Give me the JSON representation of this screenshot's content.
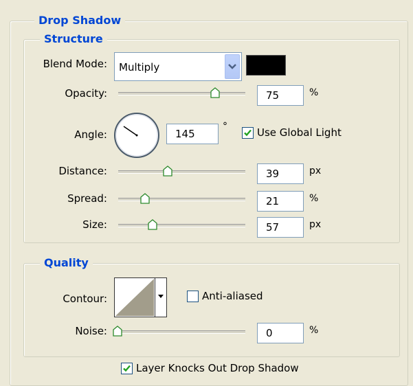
{
  "panel": {
    "title": "Drop Shadow",
    "structure": {
      "legend": "Structure",
      "blend_mode_label": "Blend Mode:",
      "blend_mode_value": "Multiply",
      "shadow_color": "#000000",
      "opacity_label": "Opacity:",
      "opacity_value": "75",
      "opacity_unit": "%",
      "opacity_level": 0.75,
      "angle_label": "Angle:",
      "angle_value": "145",
      "angle_unit": "°",
      "use_global_light_label": "Use Global Light",
      "use_global_light_checked": true,
      "distance_label": "Distance:",
      "distance_value": "39",
      "distance_unit": "px",
      "spread_label": "Spread:",
      "spread_value": "21",
      "spread_unit": "%",
      "size_label": "Size:",
      "size_value": "57",
      "size_unit": "px"
    },
    "quality": {
      "legend": "Quality",
      "contour_label": "Contour:",
      "anti_aliased_label": "Anti-aliased",
      "anti_aliased_checked": false,
      "noise_label": "Noise:",
      "noise_value": "0",
      "noise_unit": "%"
    },
    "knockout_label": "Layer Knocks Out Drop Shadow",
    "knockout_checked": true
  },
  "colors": {
    "legend": "#0046D5",
    "check": "#21A121"
  },
  "icons": [
    "chevron-down-icon",
    "checkmark-icon",
    "slider-thumb-icon",
    "angle-dial-icon"
  ]
}
